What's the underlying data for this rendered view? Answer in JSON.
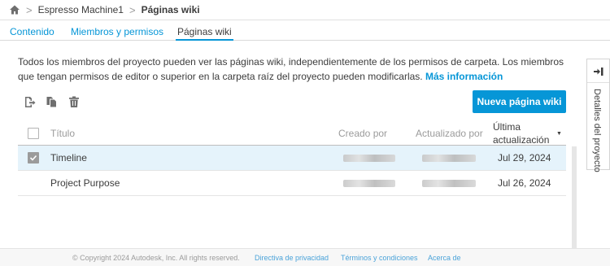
{
  "breadcrumb": {
    "project": "Espresso Machine1",
    "current": "Páginas wiki",
    "separator": ">"
  },
  "tabs": [
    {
      "label": "Contenido"
    },
    {
      "label": "Miembros y permisos"
    },
    {
      "label": "Páginas wiki",
      "active": true
    }
  ],
  "description": {
    "text": "Todos los miembros del proyecto pueden ver las páginas wiki, independientemente de los permisos de carpeta. Los miembros que tengan permisos de editor o superior en la carpeta raíz del proyecto pueden modificarlas.",
    "link": "Más información"
  },
  "toolbar": {
    "icons": [
      "export-icon",
      "copy-icon",
      "trash-icon"
    ],
    "new_button": "Nueva página wiki"
  },
  "table": {
    "headers": {
      "title": "Título",
      "created_by": "Creado por",
      "updated_by": "Actualizado por",
      "last_update_line1": "Última",
      "last_update_line2": "actualización"
    },
    "sort_indicator": "▼",
    "rows": [
      {
        "title": "Timeline",
        "date": "Jul 29, 2024",
        "selected": true
      },
      {
        "title": "Project Purpose",
        "date": "Jul 26, 2024",
        "selected": false
      }
    ]
  },
  "side_panel": {
    "label": "Detalles del proyecto"
  },
  "footer": {
    "copyright": "© Copyright 2024 Autodesk, Inc. All rights reserved.",
    "links": [
      "Directiva de privacidad",
      "Términos y condiciones",
      "Acerca de"
    ]
  },
  "colors": {
    "accent": "#0696d7",
    "selected_row": "#e5f3fb",
    "text": "#3c3c3c",
    "muted": "#9b9b9b"
  }
}
